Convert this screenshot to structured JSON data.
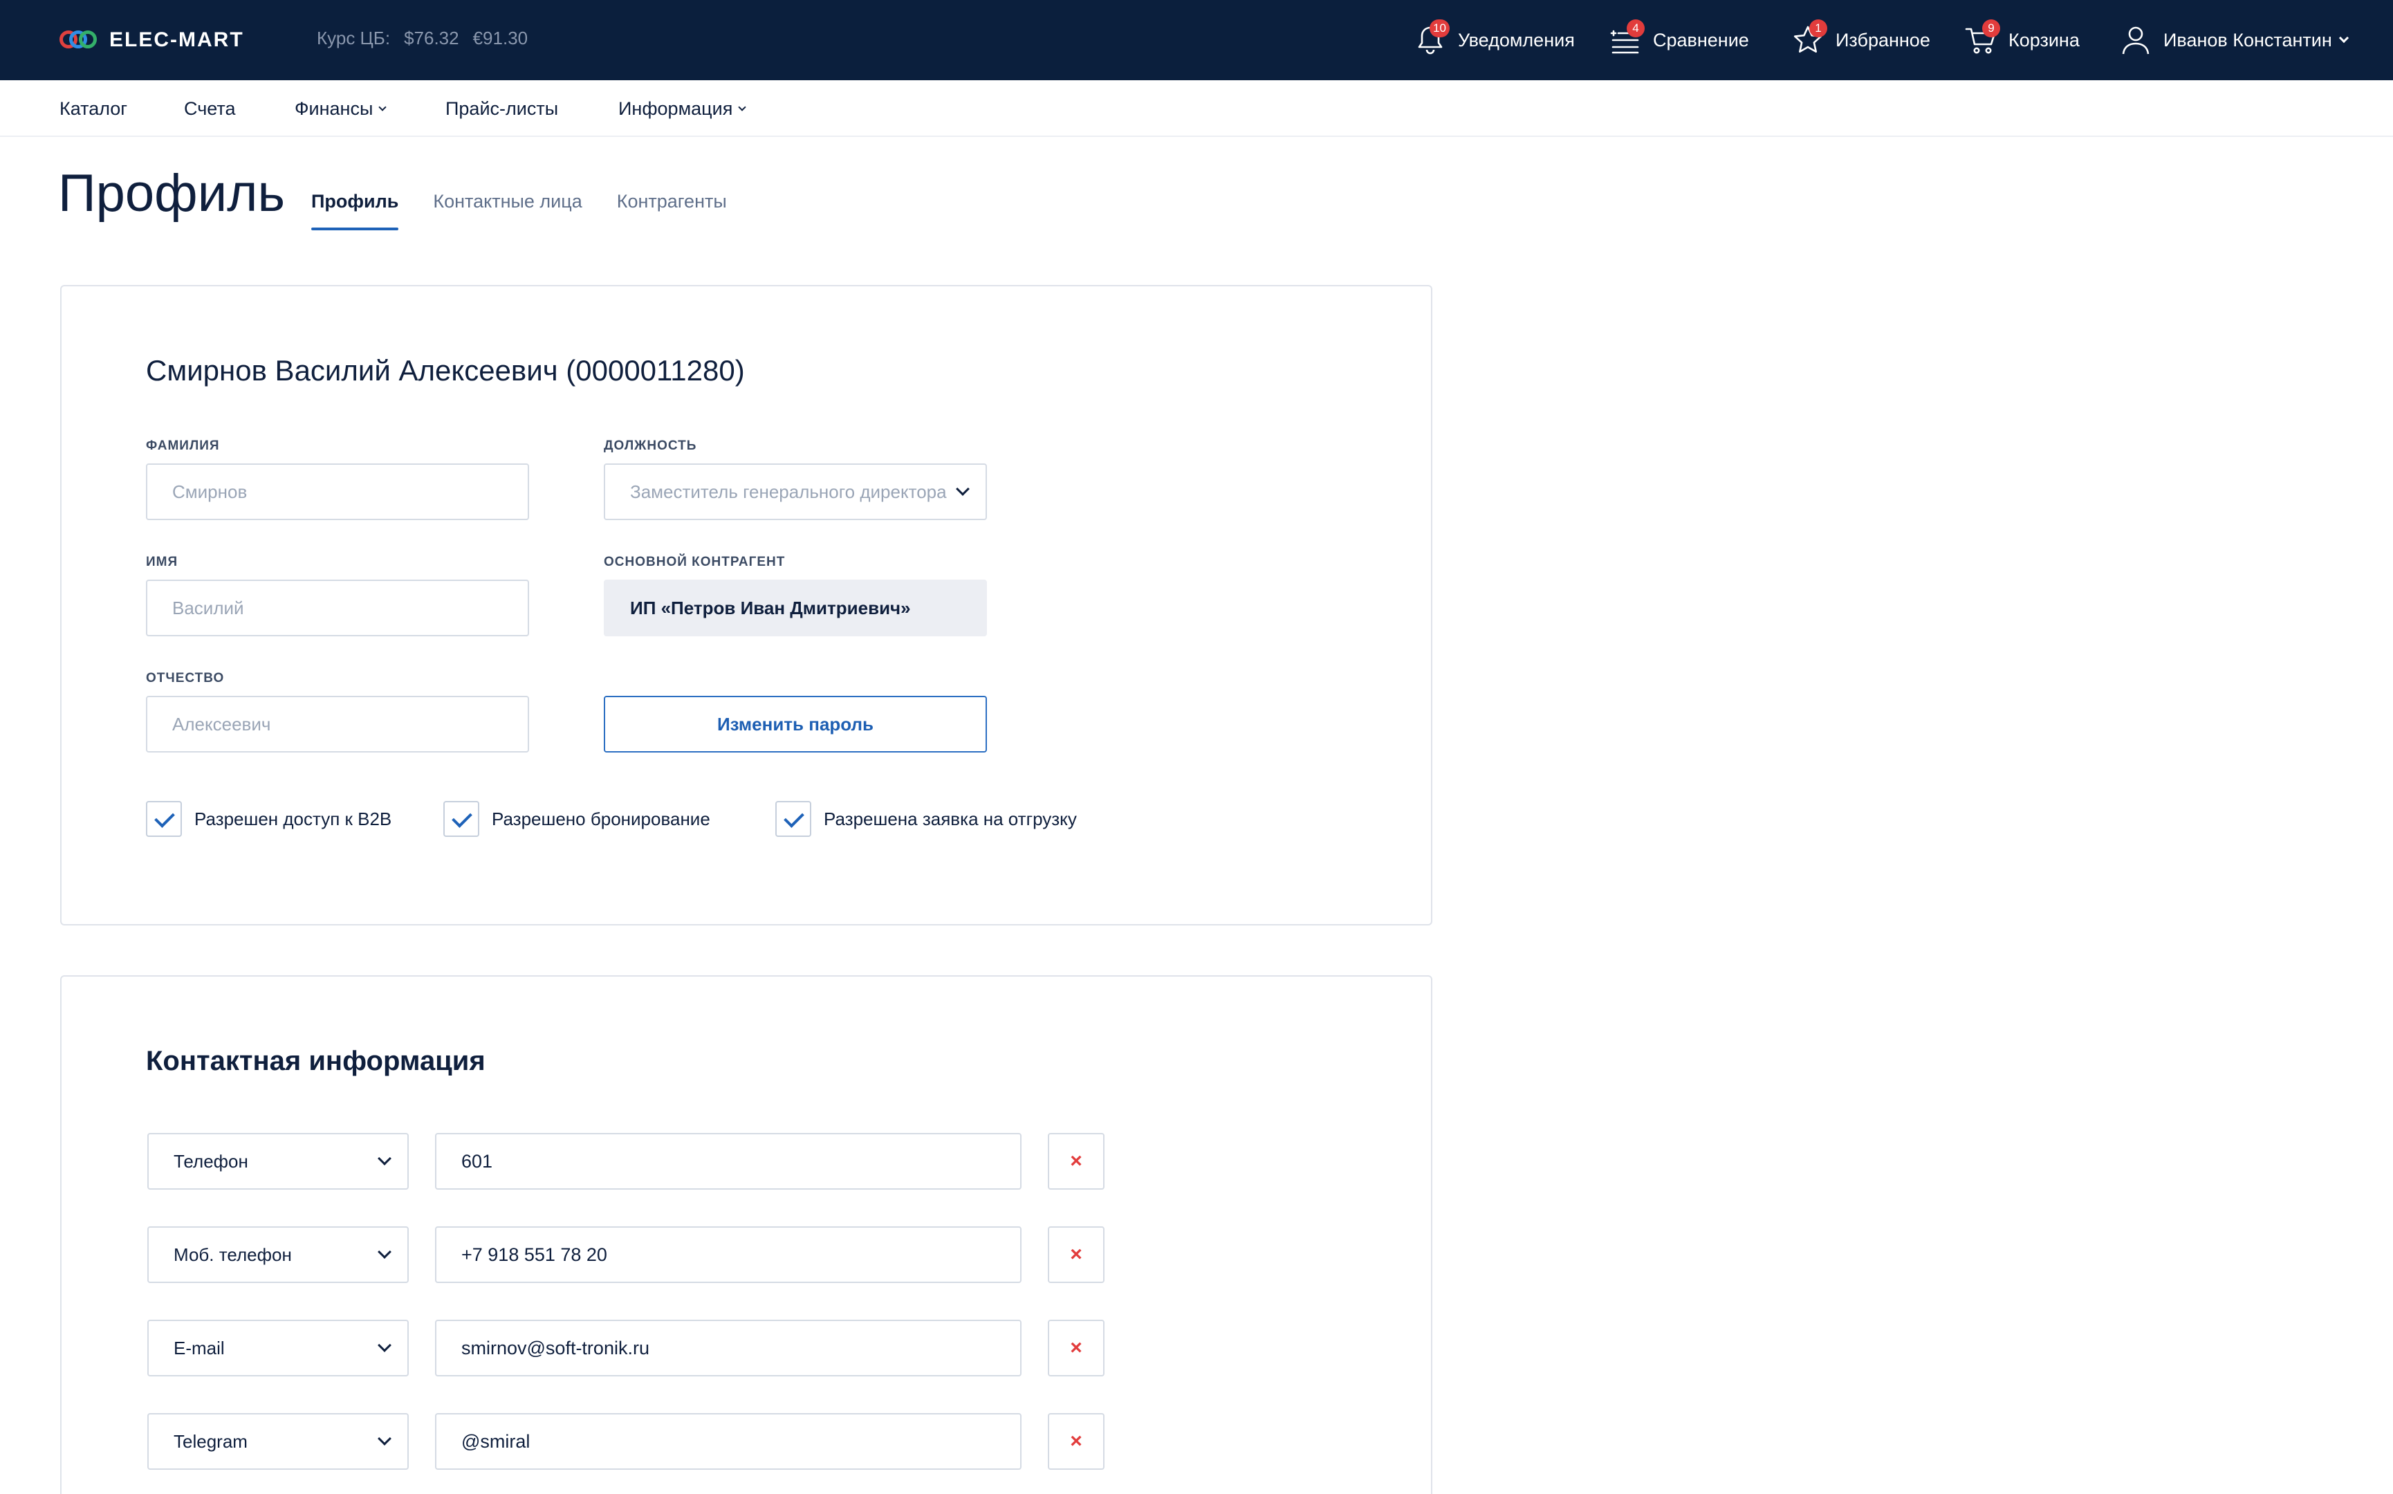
{
  "header": {
    "logo_text": "ELEC-MART",
    "rates": {
      "label": "Курс ЦБ:",
      "usd": "$76.32",
      "eur": "€91.30"
    },
    "nav": {
      "notifications": {
        "label": "Уведомления",
        "badge": "10",
        "icon": "bell-icon"
      },
      "compare": {
        "label": "Сравнение",
        "badge": "4",
        "icon": "compare-list-icon"
      },
      "favorites": {
        "label": "Избранное",
        "badge": "1",
        "icon": "star-icon"
      },
      "cart": {
        "label": "Корзина",
        "badge": "9",
        "icon": "cart-icon"
      },
      "user": {
        "label": "Иванов Константин",
        "icon": "user-icon"
      }
    }
  },
  "menu": {
    "items": [
      {
        "label": "Каталог"
      },
      {
        "label": "Счета"
      },
      {
        "label": "Финансы"
      },
      {
        "label": "Прайс-листы"
      },
      {
        "label": "Информация"
      }
    ]
  },
  "page": {
    "title": "Профиль",
    "tabs": [
      "Профиль",
      "Контактные лица",
      "Контрагенты"
    ]
  },
  "profile": {
    "title": "Смирнов Василий Алексеевич (0000011280)",
    "last_name": {
      "label": "Фамилия",
      "placeholder": "Смирнов"
    },
    "first_name": {
      "label": "Имя",
      "placeholder": "Василий"
    },
    "middle_name": {
      "label": "Отчество",
      "placeholder": "Алексеевич"
    },
    "position": {
      "label": "Должность",
      "value": "Заместитель генерального директора"
    },
    "counterparty": {
      "label": "Основной контрагент",
      "value": "ИП «Петров Иван Дмитриевич»"
    },
    "change_password": "Изменить пароль",
    "checks": [
      "Разрешен доступ к B2B",
      "Разрешено бронирование",
      "Разрешена заявка на отгрузку"
    ]
  },
  "contacts": {
    "title": "Контактная информация",
    "rows": [
      {
        "type": "Телефон",
        "value": "601"
      },
      {
        "type": "Моб. телефон",
        "value": "+7 918 551 78 20"
      },
      {
        "type": "E-mail",
        "value": "smirnov@soft-tronik.ru"
      },
      {
        "type": "Telegram",
        "value": "@smiral"
      }
    ],
    "delete_symbol": "×"
  },
  "colors": {
    "header_bg": "#0b1f3d",
    "accent": "#1e62b8",
    "badge": "#e23c3c"
  }
}
